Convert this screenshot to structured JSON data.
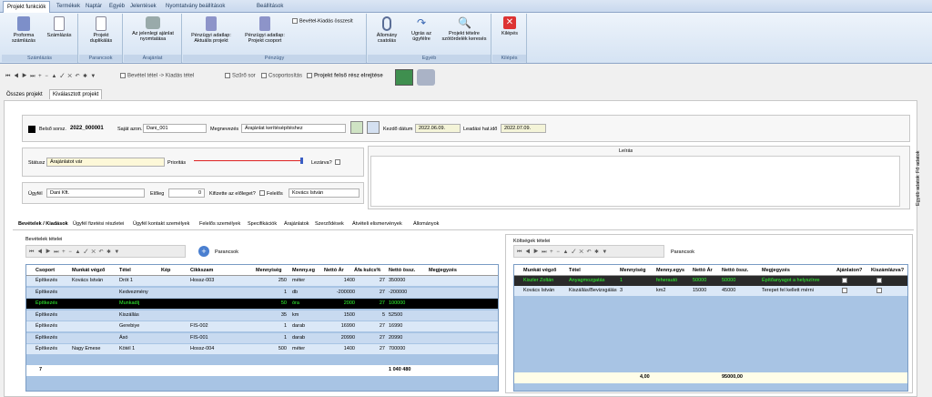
{
  "ribbon_tabs": [
    "Projekt funkciók",
    "Termékek",
    "Naptár",
    "Egyéb",
    "Jelentések",
    "Nyomtatvány beállítások",
    "Beállítások"
  ],
  "ribbon": {
    "proforma": "Proforma számlázás",
    "szamlazas": "Számlázás",
    "grp_szamlazas": "Számlázás",
    "duplikalas": "Projekt duplikálás",
    "grp_parancsok": "Parancsok",
    "nyomtatas": "Az jelenlegi ajánlat nyomtatása",
    "grp_arajanlat": "Árajánlat",
    "penz1": "Pénzügyi adatlap: Aktuális projekt",
    "penz2": "Pénzügyi adatlap: Projekt csoport",
    "bevkiad": "Bevétel-Kiadás összesít",
    "grp_penzugy": "Pénzügy",
    "allomany": "Állomány csatolás",
    "ugyfel": "Ugrás az ügyfélre",
    "tetel": "Projekt tételre szótördelék keresés",
    "grp_egyeb": "Egyéb",
    "kilepes": "Kilépés",
    "grp_kilepes": "Kilépés"
  },
  "toolbar": {
    "bevetel": "Bevétel tétel -> Kiadás tétel",
    "szuro": "Szűrő sor",
    "csoport": "Csoportosítás",
    "felso": "Projekt felső rész elrejtése"
  },
  "tabs": {
    "osszes": "Összes projekt",
    "kivalasztott": "Kiválasztott projekt"
  },
  "form": {
    "belso_lbl": "Belső sorsz.",
    "belso_val": "2022_000001",
    "sajat_lbl": "Saját azon.",
    "sajat_val": "Dani_001",
    "megnev_lbl": "Megnevezés",
    "megnev_val": "Árajánlat kerítésépítéshez",
    "kezdo_lbl": "Kezdő dátum",
    "kezdo_val": "2022.06.09.",
    "lead_lbl": "Leadási hat.idő",
    "lead_val": "2022.07.09.",
    "leiras_lbl": "Leírás",
    "statusz_lbl": "Státusz",
    "statusz_val": "Árajánlatot vár",
    "prioritas_lbl": "Prioritás",
    "lezarva_lbl": "Lezárva?",
    "ugyfel_lbl": "Ügyfél",
    "ugyfel_val": "Dani Kft.",
    "eloleg_lbl": "Előleg",
    "eloleg_val": "0",
    "kifizette_lbl": "Kifizette az előleget?",
    "felelos_lbl": "Felelős",
    "felelos_val": "Kovács István",
    "side_fo": "Fő adatok",
    "side_egyeb": "Egyéb adatok"
  },
  "lower_tabs": [
    "Bevételek / Kiadások",
    "Ügyfél fizetési részletei",
    "Ügyfél kontakt személyek",
    "Felelős személyek",
    "Specifikációk",
    "Árajánlatok",
    "Szerződések",
    "Átvételi elismervények",
    "Állományok"
  ],
  "bev": {
    "title": "Bevételek tételei",
    "parancsok": "Parancsok",
    "headers": [
      "Csoport",
      "Munkát végző",
      "Tétel",
      "Kép",
      "Cikkszam",
      "Mennyiség",
      "Menny.eg",
      "Nettó Ár",
      "Áfa kulcs%",
      "Nettó össz.",
      "Megjegyzés"
    ],
    "rows": [
      [
        "Építkezés",
        "Kovács István",
        "Drót 1",
        "",
        "Hossz-003",
        "250",
        "méter",
        "1400",
        "27",
        "350000",
        ""
      ],
      [
        "Építkezés",
        "",
        "Kedvezmény",
        "",
        "",
        "1",
        "db",
        "-200000",
        "27",
        "-200000",
        ""
      ],
      [
        "Építkezés",
        "",
        "Munkadíj",
        "",
        "",
        "50",
        "óra",
        "2000",
        "27",
        "100000",
        ""
      ],
      [
        "Építkezés",
        "",
        "Kiszállás",
        "",
        "",
        "35",
        "km",
        "1500",
        "5",
        "52500",
        ""
      ],
      [
        "Építkezés",
        "",
        "Gerebiye",
        "",
        "FIS-002",
        "1",
        "darab",
        "16990",
        "27",
        "16990",
        ""
      ],
      [
        "Építkezés",
        "",
        "Ásó",
        "",
        "FIS-001",
        "1",
        "darab",
        "20990",
        "27",
        "20990",
        ""
      ],
      [
        "Építkezés",
        "Nagy Emese",
        "Kötél 1",
        "",
        "Hossz-004",
        "500",
        "méter",
        "1400",
        "27",
        "700000",
        ""
      ]
    ],
    "footer_count": "7",
    "footer_total": "1 040 480"
  },
  "kolt": {
    "title": "Költségek tételei",
    "parancsok": "Parancsok",
    "headers": [
      "Munkát végző",
      "Tétel",
      "Mennyiség",
      "Menny.egys",
      "Nettó Ár",
      "Nettó össz.",
      "Megjegyzés",
      "Ajánlaton?",
      "Kiszámlázva?"
    ],
    "rows": [
      [
        "Kiszler Zoltán",
        "Anyagmozgatás",
        "1",
        "feherautó",
        "50000",
        "50000",
        "Építőanyagot a helyszínre"
      ],
      [
        "Kovács István",
        "Kiszállás/Bevizsgálás",
        "3",
        "km2",
        "15000",
        "45000",
        "Terepet fel kellett mérni"
      ]
    ],
    "footer_qty": "4,00",
    "footer_total": "95000,00"
  }
}
